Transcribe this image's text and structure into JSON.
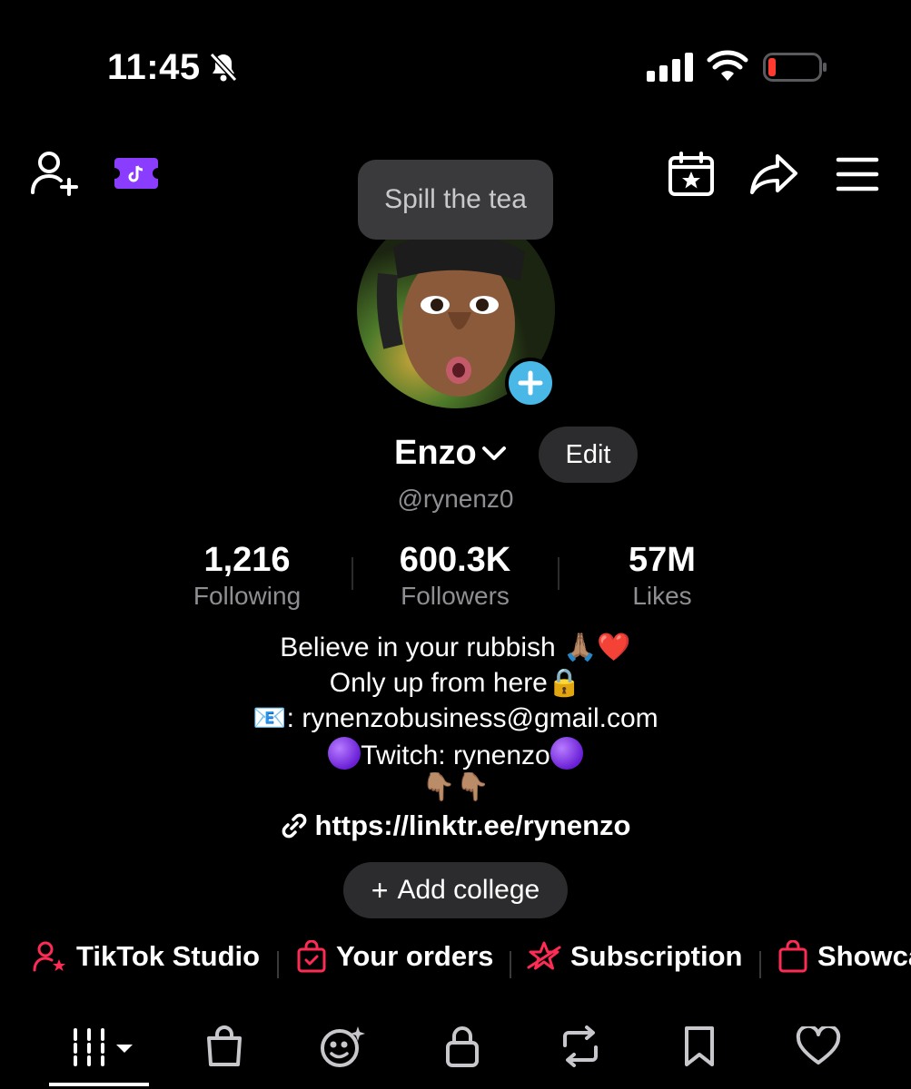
{
  "status_bar": {
    "time": "11:45"
  },
  "tooltip": {
    "text": "Spill the tea"
  },
  "profile": {
    "name": "Enzo",
    "edit_label": "Edit",
    "handle": "@rynenz0"
  },
  "stats": [
    {
      "value": "1,216",
      "label": "Following"
    },
    {
      "value": "600.3K",
      "label": "Followers"
    },
    {
      "value": "57M",
      "label": "Likes"
    }
  ],
  "bio": {
    "line1": "Believe in your rubbish 🙏🏽❤️",
    "line2": "Only up from here🔒",
    "line3_prefix": "📧: ",
    "line3": "rynenzobusiness@gmail.com",
    "line4": "Twitch: rynenzo",
    "line5": "👇🏽👇🏽"
  },
  "link": "https://linktr.ee/rynenzo",
  "college_button": "Add college",
  "shortcuts": [
    {
      "label": "TikTok Studio",
      "icon": "person-star-icon"
    },
    {
      "label": "Your orders",
      "icon": "order-bag-icon"
    },
    {
      "label": "Subscription",
      "icon": "subscription-star-icon"
    },
    {
      "label": "Showca",
      "icon": "showcase-bag-icon"
    }
  ],
  "tabs": [
    {
      "name": "videos-grid-tab",
      "icon": "grid-dropdown-icon",
      "selected": true
    },
    {
      "name": "shop-tab",
      "icon": "shopping-bag-icon"
    },
    {
      "name": "ai-self-tab",
      "icon": "sparkle-face-icon"
    },
    {
      "name": "private-tab",
      "icon": "lock-icon"
    },
    {
      "name": "reposts-tab",
      "icon": "repost-icon"
    },
    {
      "name": "favorites-tab",
      "icon": "bookmark-icon"
    },
    {
      "name": "liked-tab",
      "icon": "heart-icon"
    }
  ],
  "colors": {
    "background": "#000000",
    "accent_red": "#fe2c55",
    "secondary_text": "#8e8e93",
    "avatar_plus": "#49b8e6",
    "ticket_purple": "#8b3dff",
    "battery_low": "#ff3b30"
  }
}
